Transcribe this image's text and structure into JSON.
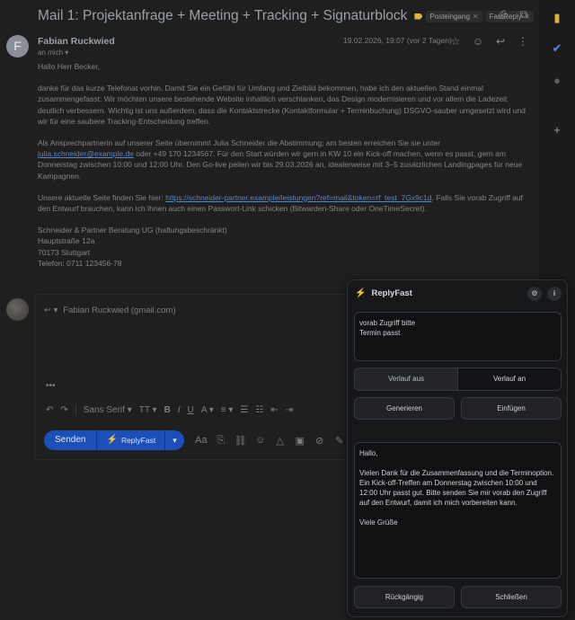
{
  "email": {
    "subject": "Mail 1: Projektanfrage + Meeting + Tracking + Signaturblock",
    "labels": [
      {
        "text": "Posteingang"
      },
      {
        "text": "FastReply"
      }
    ],
    "sender_name": "Fabian Ruckwied",
    "avatar_letter": "F",
    "to_line": "an mich",
    "date": "19.02.2026, 19:07 (vor 2 Tagen)",
    "greeting": "Hallo Herr Becker,",
    "p1": "danke für das kurze Telefonat vorhin. Damit Sie ein Gefühl für Umfang und Zielbild bekommen, habe ich den aktuellen Stand einmal zusammengefasst: Wir möchten unsere bestehende Website inhaltlich verschlanken, das Design modernisieren und vor allem die Ladezeit deutlich verbessern. Wichtig ist uns außerdem, dass die Kontaktstrecke (Kontaktformular + Terminbuchung) DSGVO-sauber umgesetzt wird und wir für eine saubere Tracking-Entscheidung treffen.",
    "p2_pre": "Als Ansprechpartnerin auf unserer Seite übernimmt Julia Schneider die Abstimmung; am besten erreichen Sie sie unter ",
    "p2_link": "julia.schneider@example.de",
    "p2_post": " oder +49 170 1234567. Für den Start würden wir gern in KW 10 ein Kick-off machen, wenn es passt, gern am Donnerstag zwischen 10:00 und 12:00 Uhr. Den Go-live peilen wir bis 29.03.2026 an, idealerweise mit 3–5 zusätzlichen Landingpages für neue Kampagnen.",
    "p3_pre": "Unsere aktuelle Seite finden Sie hier: ",
    "p3_link": "https://schneider-partner.example/leistungen?ref=mail&token=rf_test_7Gx9c1d",
    "p3_post": ". Falls Sie vorab Zugriff auf den Entwurf brauchen, kann ich Ihnen auch einen Passwort-Link schicken (Bitwarden-Share oder OneTimeSecret).",
    "signature": [
      "Schneider & Partner Beratung UG (haftungsbeschränkt)",
      "Hauptstraße 12a",
      "70173 Stuttgart",
      "Telefon: 0711 123456-78"
    ]
  },
  "reply": {
    "to": "Fabian Ruckwied (gmail.com)",
    "font": "Sans Serif",
    "send_label": "Senden",
    "replyfast_label": "ReplyFast"
  },
  "panel": {
    "title": "ReplyFast",
    "input_text": "vorab Zugriff bitte\nTermin passt",
    "history_off": "Verlauf aus",
    "history_on": "Verlauf an",
    "generate": "Generieren",
    "insert": "Einfügen",
    "output_text": "Hallo,\n\nVielen Dank für die Zusammenfassung und die Terminoption. Ein Kick-off-Treffen am Donnerstag zwischen 10:00 und 12:00 Uhr passt gut. Bitte senden Sie mir vorab den Zugriff auf den Entwurf, damit ich mich vorbereiten kann.\n\nViele Grüße",
    "undo": "Rückgängig",
    "close": "Schließen"
  },
  "colors": {
    "accent": "#1d4fb8",
    "bolt": "#e8b23a",
    "link": "#5b84c4"
  }
}
